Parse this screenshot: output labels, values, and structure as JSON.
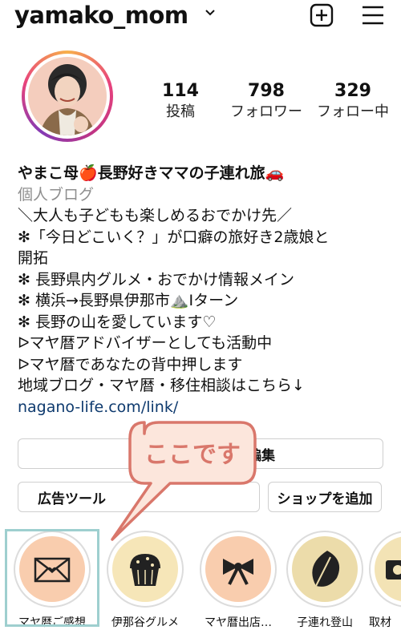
{
  "header": {
    "username": "yamako_mom"
  },
  "profile": {
    "stats": [
      {
        "value": "114",
        "label": "投稿"
      },
      {
        "value": "798",
        "label": "フォロワー"
      },
      {
        "value": "329",
        "label": "フォロー中"
      }
    ],
    "display_name": "やまこ母🍎長野好きママの子連れ旅🚗",
    "category": "個人ブログ",
    "bio_lines": [
      "＼大人も子どもも楽しめるおでかけ先／",
      "✻「今日どこいく？」が口癖の旅好き2歳娘と",
      "開拓",
      "✻ 長野県内グルメ・おでかけ情報メイン",
      "✻ 横浜→長野県伊那市⛰️Iターン",
      "✻ 長野の山を愛しています♡",
      "ᐅマヤ暦アドバイザーとしても活動中",
      "ᐅマヤ暦であなたの背中押します",
      "地域ブログ・マヤ暦・移住相談はこちら↓"
    ],
    "link": "nagano-life.com/link/"
  },
  "buttons": {
    "edit_partial": "編集",
    "ad_tools": "広告ツール",
    "add_shop": "ショップを追加"
  },
  "callout": {
    "text": "ここです"
  },
  "highlights": [
    {
      "label": "マヤ暦ご感想",
      "icon": "envelope-icon",
      "bg": "#f9cdae"
    },
    {
      "label": "伊那谷グルメ",
      "icon": "muffin-icon",
      "bg": "#f6e6b8"
    },
    {
      "label": "マヤ暦出店…",
      "icon": "ribbon-icon",
      "bg": "#f9cdae"
    },
    {
      "label": "子連れ登山",
      "icon": "leaf-icon",
      "bg": "#ecdcaa"
    },
    {
      "label": "取材",
      "icon": "camera-icon",
      "bg": "#f3e3b5"
    }
  ],
  "colors": {
    "callout_fill": "#fce6dc",
    "callout_stroke": "#d9776b",
    "selection_box": "#9ecfcf",
    "story_ring": "#e8437c"
  }
}
